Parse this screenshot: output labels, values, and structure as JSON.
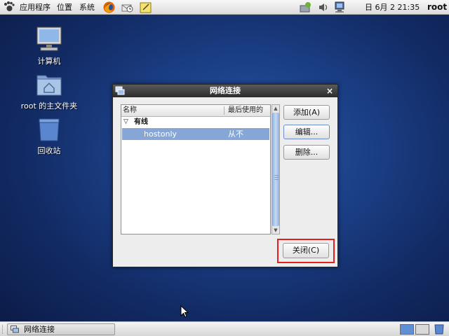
{
  "top_panel": {
    "menus": [
      "应用程序",
      "位置",
      "系统"
    ],
    "clock": "日 6月  2 21:35",
    "user": "root"
  },
  "desktop_icons": [
    {
      "label": "计算机",
      "icon": "computer-icon"
    },
    {
      "label": "root 的主文件夹",
      "icon": "home-folder-icon"
    },
    {
      "label": "回收站",
      "icon": "trash-icon"
    }
  ],
  "dialog": {
    "title": "网络连接",
    "close_symbol": "×",
    "columns": [
      "名称",
      "最后使用的"
    ],
    "group": "有线",
    "connections": [
      {
        "name": "hostonly",
        "last_used": "从不"
      }
    ],
    "buttons": {
      "add": "添加(A)",
      "edit": "编辑...",
      "delete": "删除...",
      "close": "关闭(C)"
    }
  },
  "taskbar": {
    "window_label": "网络连接"
  },
  "colors": {
    "selection": "#86a6d6",
    "highlight": "#e22020",
    "desktop": "#1b3f86"
  }
}
